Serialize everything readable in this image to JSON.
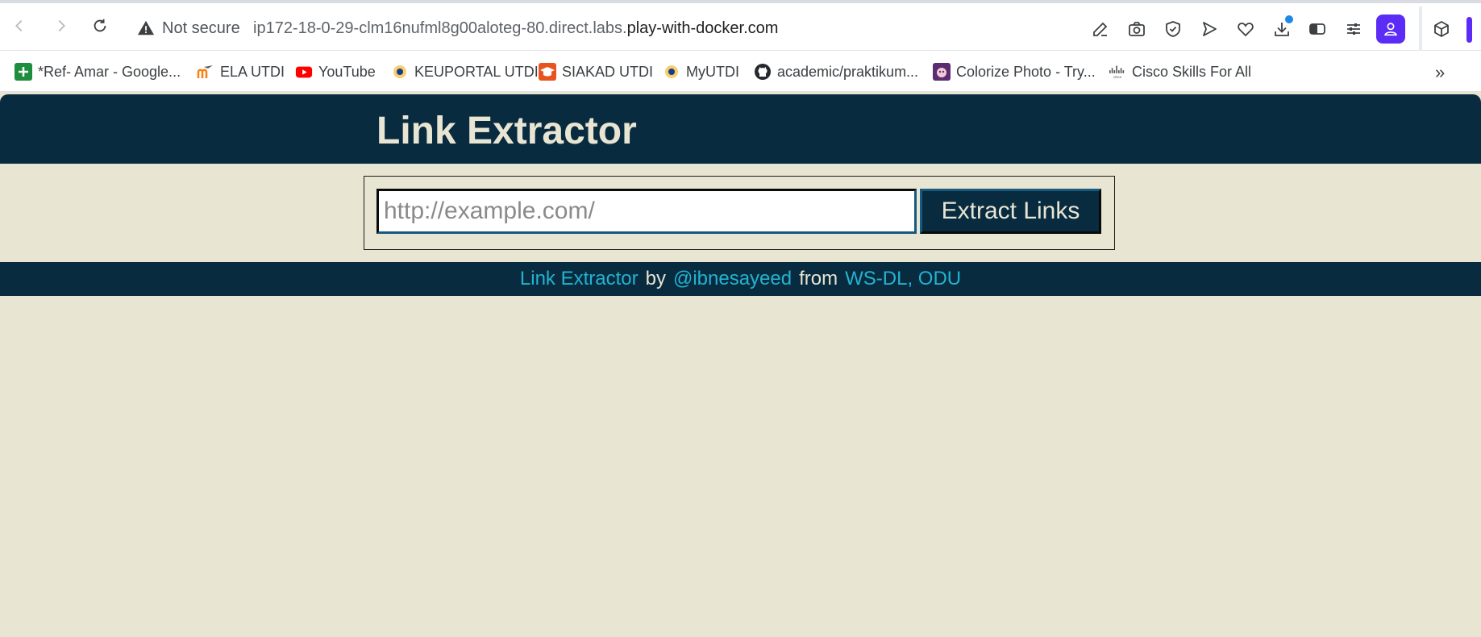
{
  "browser": {
    "security_label": "Not secure",
    "url_prefix": "ip172-18-0-29-clm16nufml8g00aloteg-80.direct.labs.",
    "url_domain": "play-with-docker.com",
    "profile_color": "#5b2cf5",
    "toolbar_icons": [
      "edit-icon",
      "camera-icon",
      "shield-check-icon",
      "send-icon",
      "heart-icon",
      "download-icon",
      "sidebar-icon",
      "tune-icon",
      "profile-icon",
      "cube-icon"
    ]
  },
  "bookmarks": {
    "items": [
      {
        "label": "*Ref- Amar - Google...",
        "icon": "google-sheets-icon",
        "color": "#1e8e3e"
      },
      {
        "label": "ELA UTDI",
        "icon": "moodle-icon",
        "color": "#f98012"
      },
      {
        "label": "YouTube",
        "icon": "youtube-icon",
        "color": "#ff0000"
      },
      {
        "label": "KEUPORTAL UTDI",
        "icon": "utdi-logo-icon",
        "color": "#1a3a8a"
      },
      {
        "label": "SIAKAD UTDI",
        "icon": "graduation-cap-icon",
        "color": "#e8541f"
      },
      {
        "label": "MyUTDI",
        "icon": "utdi-logo-icon",
        "color": "#1a3a8a"
      },
      {
        "label": "academic/praktikum...",
        "icon": "github-icon",
        "color": "#24292f"
      },
      {
        "label": "Colorize Photo - Try...",
        "icon": "colorize-icon",
        "color": "#5b2c6f"
      },
      {
        "label": "Cisco Skills For All",
        "icon": "cisco-icon",
        "color": "#444444"
      }
    ],
    "more_label": "»"
  },
  "page": {
    "title": "Link Extractor",
    "input": {
      "placeholder": "http://example.com/",
      "value": ""
    },
    "button_label": "Extract Links",
    "footer": {
      "app_link": "Link Extractor",
      "by_text": "by",
      "author_link": "@ibnesayeed",
      "from_text": "from",
      "org_link": "WS-DL, ODU"
    },
    "colors": {
      "header_bg": "#082b40",
      "page_bg": "#e8e5d3",
      "link": "#23b3cf"
    }
  }
}
